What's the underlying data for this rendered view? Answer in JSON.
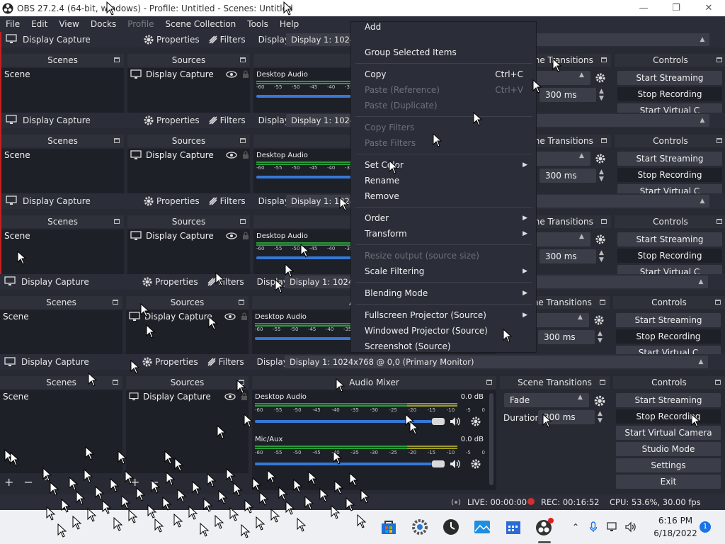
{
  "window": {
    "title": "OBS 27.2.4 (64-bit, windows) - Profile: Untitled - Scenes: Untitled"
  },
  "menu": [
    "File",
    "Edit",
    "View",
    "Docks",
    "Profile",
    "Scene Collection",
    "Tools",
    "Help"
  ],
  "context_bar": {
    "source": "Display Capture",
    "properties": "Properties",
    "filters": "Filters",
    "display_label": "Display",
    "display_value": "Display 1: 1024x768 @ 0,0 (Primary Monitor)"
  },
  "docks": {
    "scenes": "Scenes",
    "sources": "Sources",
    "audio_mixer": "Audio Mixer",
    "scene_transitions": "Scene Transitions",
    "controls": "Controls"
  },
  "scenes": [
    "Scene"
  ],
  "sources": [
    "Display Capture"
  ],
  "mixer": {
    "channels": [
      {
        "name": "Desktop Audio",
        "db": "0.0 dB",
        "level": 0.88
      },
      {
        "name": "Mic/Aux",
        "db": "0.0 dB",
        "level": 0.88
      }
    ],
    "ticks": [
      "-60",
      "-55",
      "-50",
      "-45",
      "-40",
      "-35",
      "-30",
      "-25",
      "-20",
      "-15",
      "-10",
      "-5",
      "0"
    ]
  },
  "transitions": {
    "type": "Fade",
    "duration_label": "Duration",
    "duration": "300 ms"
  },
  "controls": [
    "Start Streaming",
    "Stop Recording",
    "Start Virtual Camera",
    "Studio Mode",
    "Settings",
    "Exit"
  ],
  "ghost_controls_partial": "Start Virtual C",
  "status": {
    "live": "LIVE: 00:00:00",
    "rec": "REC: 00:16:52",
    "cpu": "CPU: 53.6%, 30.00 fps"
  },
  "context_menu": {
    "top_partial": "Add",
    "items": [
      {
        "label": "Group Selected Items",
        "enabled": true
      },
      {
        "sep": true
      },
      {
        "label": "Copy",
        "shortcut": "Ctrl+C",
        "enabled": true
      },
      {
        "label": "Paste (Reference)",
        "shortcut": "Ctrl+V",
        "enabled": false
      },
      {
        "label": "Paste (Duplicate)",
        "enabled": false
      },
      {
        "sep": true
      },
      {
        "label": "Copy Filters",
        "enabled": false
      },
      {
        "label": "Paste Filters",
        "enabled": false
      },
      {
        "sep": true
      },
      {
        "label": "Set Color",
        "submenu": true,
        "enabled": true
      },
      {
        "label": "Rename",
        "enabled": true
      },
      {
        "label": "Remove",
        "enabled": true
      },
      {
        "sep": true
      },
      {
        "label": "Order",
        "submenu": true,
        "enabled": true
      },
      {
        "label": "Transform",
        "submenu": true,
        "enabled": true
      },
      {
        "sep": true
      },
      {
        "label": "Resize output (source size)",
        "enabled": false
      },
      {
        "label": "Scale Filtering",
        "submenu": true,
        "enabled": true
      },
      {
        "sep": true
      },
      {
        "label": "Blending Mode",
        "submenu": true,
        "enabled": true
      },
      {
        "sep": true
      },
      {
        "label": "Fullscreen Projector (Source)",
        "submenu": true,
        "enabled": true
      },
      {
        "label": "Windowed Projector (Source)",
        "enabled": true
      },
      {
        "label": "Screenshot (Source)",
        "enabled": true
      }
    ]
  },
  "taskbar": {
    "time": "6:16 PM",
    "date": "6/18/2022",
    "notifications": "1"
  },
  "colors": {
    "bg": "#272a33",
    "panel": "#1e2028",
    "accent": "#3678d6",
    "rec": "#d03030"
  }
}
